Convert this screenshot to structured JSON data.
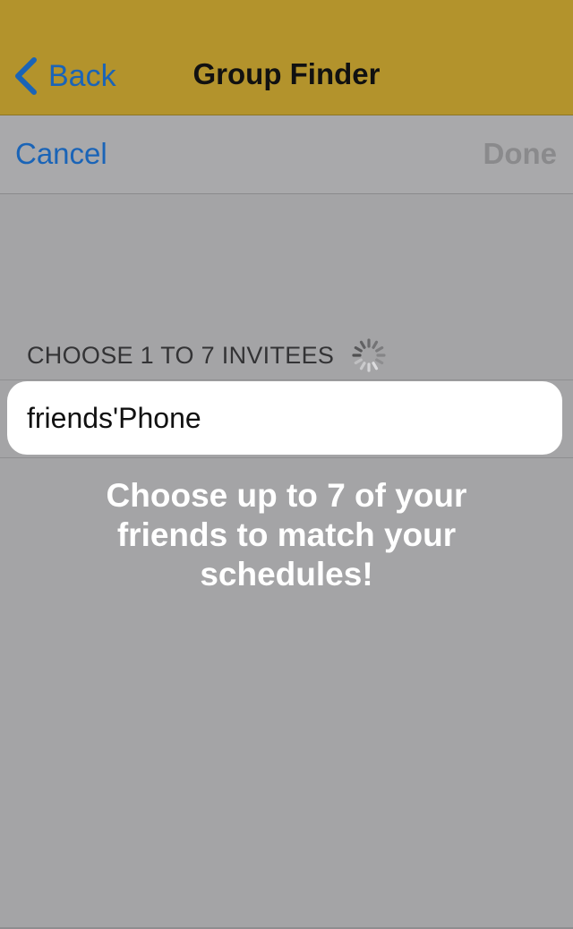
{
  "navbar": {
    "back_label": "Back",
    "title": "Group Finder",
    "color": "#b3932c"
  },
  "toolbar": {
    "cancel_label": "Cancel",
    "done_label": "Done"
  },
  "invitees": {
    "section_label": "CHOOSE 1 TO 7 INVITEES",
    "input_value": "friends'Phone"
  },
  "hint": {
    "text": "Choose up to 7 of your friends to match your schedules!"
  },
  "icons": {
    "back": "chevron-left-icon",
    "loading": "spinner-icon"
  },
  "colors": {
    "link": "#1a64b7",
    "background": "#a4a4a6",
    "disabled": "#8a8a8c"
  }
}
